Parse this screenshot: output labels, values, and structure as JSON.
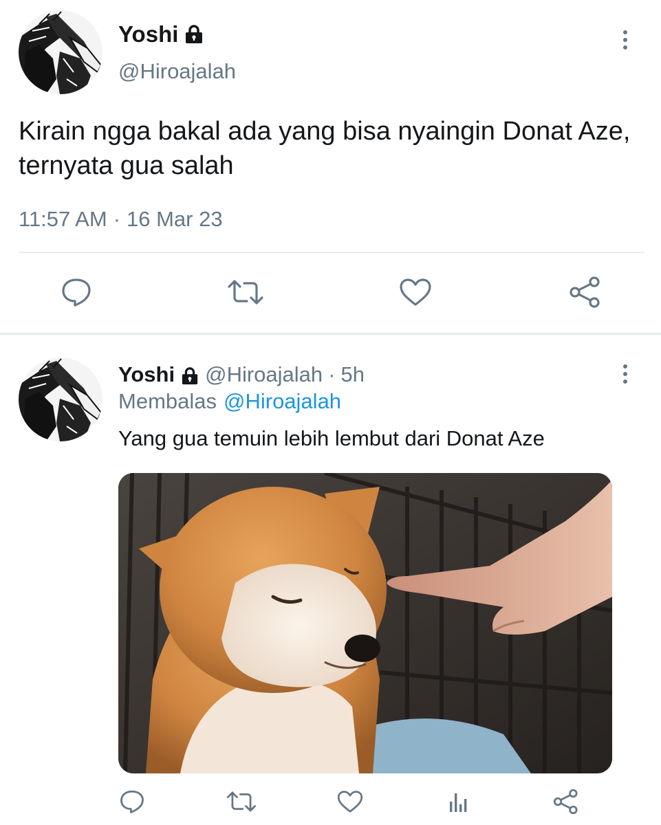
{
  "main_tweet": {
    "display_name": "Yoshi",
    "handle": "@Hiroajalah",
    "text": "Kirain ngga bakal ada yang bisa nyaingin Donat Aze, ternyata gua salah",
    "time": "11:57 AM",
    "separator": "·",
    "date": "16 Mar 23",
    "icons": [
      "lock-icon",
      "more-vertical-icon",
      "reply-icon",
      "retweet-icon",
      "like-icon",
      "share-icon"
    ]
  },
  "reply_tweet": {
    "display_name": "Yoshi",
    "handle": "@Hiroajalah",
    "age_separator": "·",
    "age": "5h",
    "replying_label": "Membalas",
    "replying_to": "@Hiroajalah",
    "text": "Yang gua temuin lebih lembut dari Donat Aze",
    "media_description_icon": "photo",
    "icons": [
      "lock-icon",
      "more-vertical-icon",
      "reply-icon",
      "retweet-icon",
      "like-icon",
      "analytics-icon",
      "share-icon"
    ]
  },
  "colors": {
    "text": "#14171a",
    "muted": "#657786",
    "link": "#1b95e0",
    "divider": "#e6ecf0"
  }
}
